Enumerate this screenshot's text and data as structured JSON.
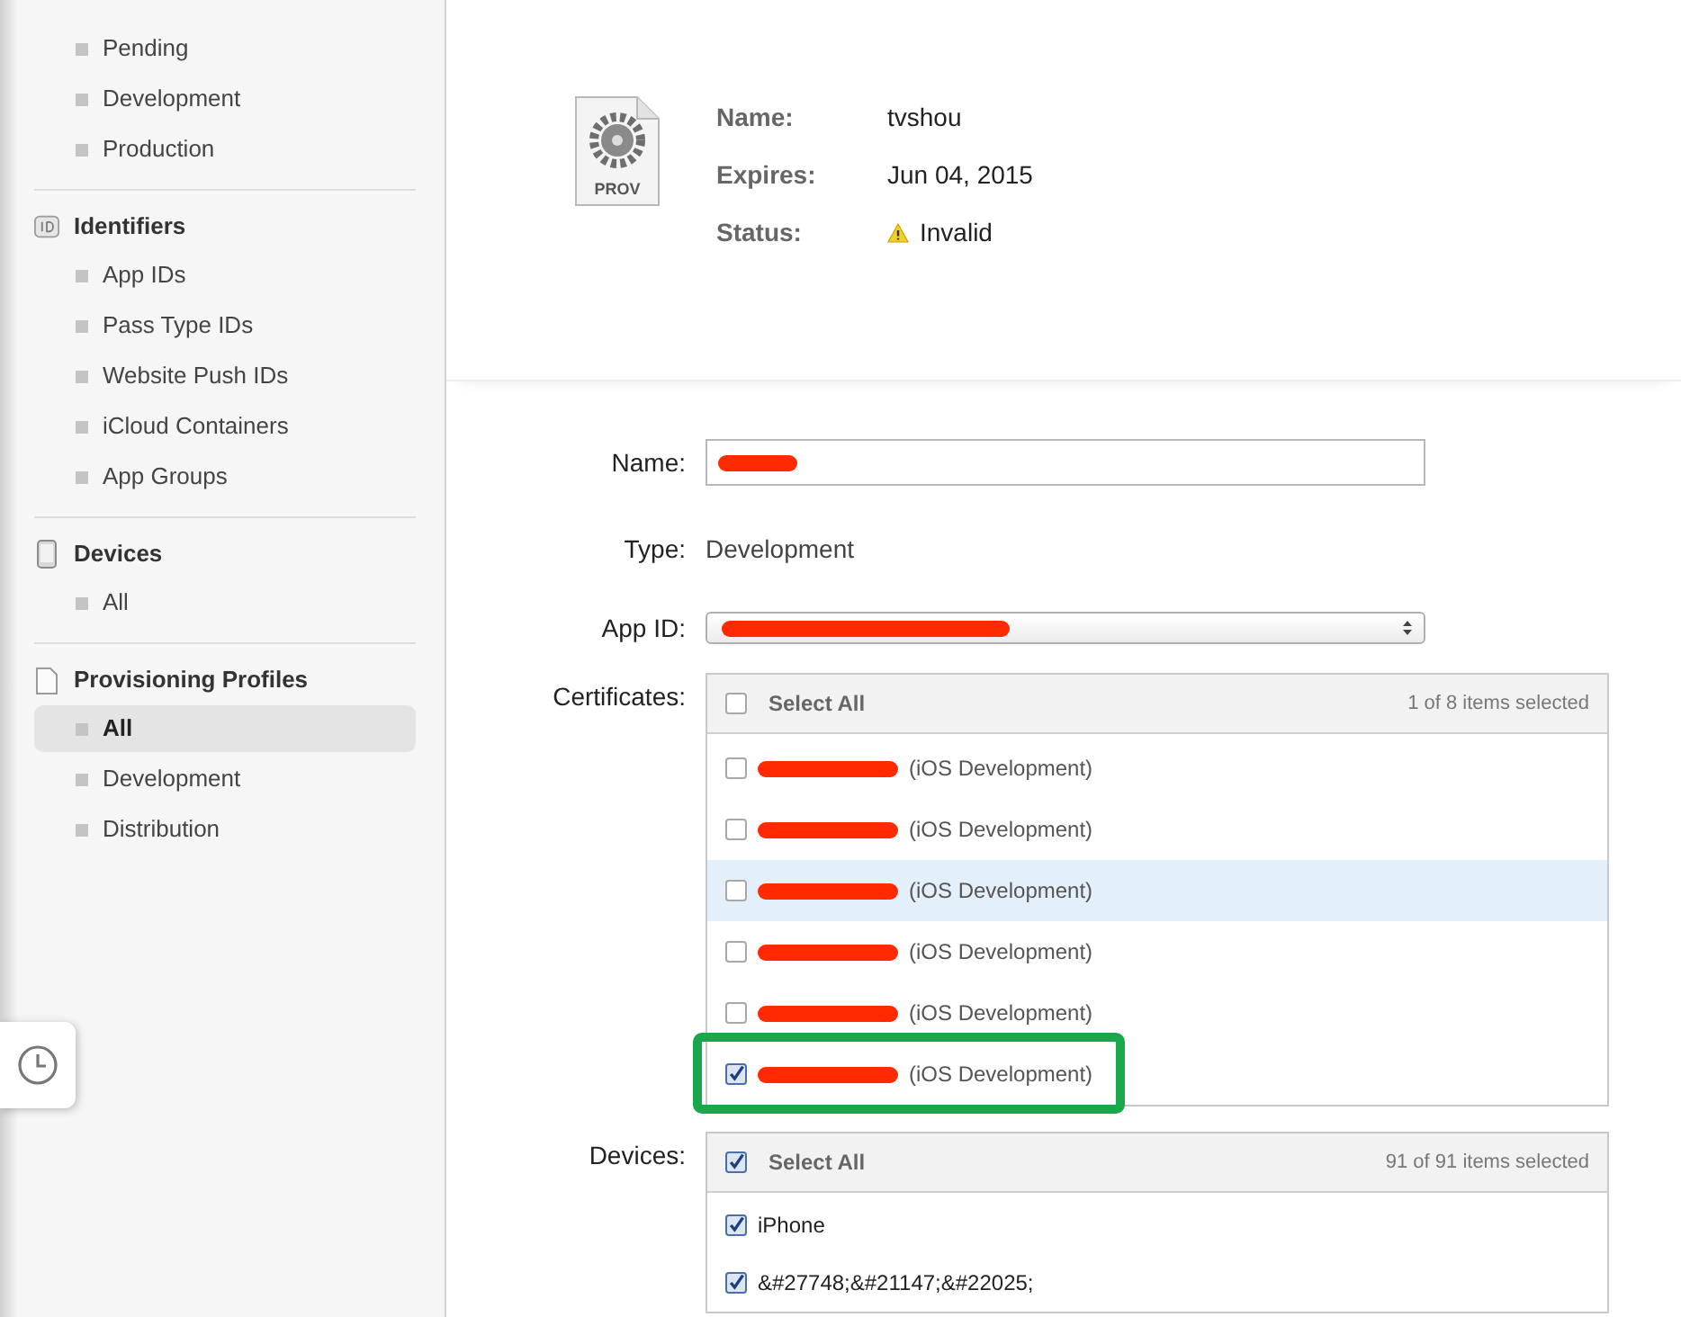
{
  "sidebar": {
    "sections": [
      {
        "items": [
          {
            "label": "Pending",
            "selected": false
          },
          {
            "label": "Development",
            "selected": false
          },
          {
            "label": "Production",
            "selected": false
          }
        ]
      },
      {
        "kind": "identifiers",
        "title": "Identifiers",
        "items": [
          {
            "label": "App IDs",
            "selected": false
          },
          {
            "label": "Pass Type IDs",
            "selected": false
          },
          {
            "label": "Website Push IDs",
            "selected": false
          },
          {
            "label": "iCloud Containers",
            "selected": false
          },
          {
            "label": "App Groups",
            "selected": false
          }
        ]
      },
      {
        "kind": "devices",
        "title": "Devices",
        "items": [
          {
            "label": "All",
            "selected": false
          }
        ]
      },
      {
        "kind": "profiles",
        "title": "Provisioning Profiles",
        "items": [
          {
            "label": "All",
            "selected": true
          },
          {
            "label": "Development",
            "selected": false
          },
          {
            "label": "Distribution",
            "selected": false
          }
        ]
      }
    ]
  },
  "profile": {
    "file_badge": "PROV",
    "fields": [
      {
        "label": "Name:",
        "value": "tvshou"
      },
      {
        "label": "Expires:",
        "value": "Jun 04, 2015"
      },
      {
        "label": "Status:",
        "value": "Invalid",
        "warning": true
      }
    ]
  },
  "form": {
    "name": {
      "label": "Name:",
      "redacted": true
    },
    "type": {
      "label": "Type:",
      "value": "Development"
    },
    "app_id": {
      "label": "App ID:",
      "redacted": true
    },
    "certificates": {
      "label": "Certificates:",
      "select_all": {
        "label": "Select All",
        "checked": false
      },
      "count": "1 of 8 items selected",
      "items": [
        {
          "text": "(iOS Development)",
          "checked": false,
          "redacted": true,
          "hovered": false,
          "annotated": false
        },
        {
          "text": "(iOS Development)",
          "checked": false,
          "redacted": true,
          "hovered": false,
          "annotated": false
        },
        {
          "text": "(iOS Development)",
          "checked": false,
          "redacted": true,
          "hovered": true,
          "annotated": false
        },
        {
          "text": "(iOS Development)",
          "checked": false,
          "redacted": true,
          "hovered": false,
          "annotated": false
        },
        {
          "text": "(iOS Development)",
          "checked": false,
          "redacted": true,
          "hovered": false,
          "annotated": false
        },
        {
          "text": "(iOS Development)",
          "checked": true,
          "redacted": true,
          "hovered": false,
          "annotated": true
        }
      ]
    },
    "devices": {
      "label": "Devices:",
      "select_all": {
        "label": "Select All",
        "checked": true
      },
      "count": "91 of 91 items selected",
      "items": [
        {
          "text": "iPhone",
          "checked": true,
          "redacted": false,
          "hovered": false,
          "annotated": false
        },
        {
          "text": "&#27748;&#21147;&#22025;",
          "checked": true,
          "redacted": false,
          "hovered": false,
          "annotated": false
        }
      ]
    }
  }
}
